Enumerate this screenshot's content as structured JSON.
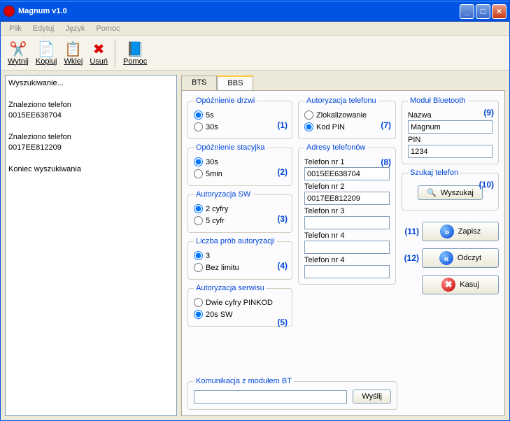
{
  "window": {
    "title": "Magnum v1.0"
  },
  "menu": {
    "file": "Plik",
    "edit": "Edytuj",
    "lang": "Język",
    "help": "Pomoc"
  },
  "toolbar": {
    "cut": "Wytnij",
    "copy": "Kopiuj",
    "paste": "Wklej",
    "delete": "Usuń",
    "help": "Pomoc"
  },
  "log": {
    "searching": "Wyszukiwanie...",
    "found1a": "Znaleziono telefon",
    "found1b": "0015EE638704",
    "found2a": "Znaleziono telefon",
    "found2b": "0017EE812209",
    "end": "Koniec wyszukiwania"
  },
  "tabs": {
    "bts": "BTS",
    "bbs": "BBS"
  },
  "groups": {
    "doorDelay": {
      "title": "Opóźnienie drzwi",
      "opt1": "5s",
      "opt2": "30s",
      "num": "(1)"
    },
    "ignDelay": {
      "title": "Opóźnienie stacyjka",
      "opt1": "30s",
      "opt2": "5min",
      "num": "(2)"
    },
    "authSW": {
      "title": "Autoryzacja SW",
      "opt1": "2 cyfry",
      "opt2": "5 cyfr",
      "num": "(3)"
    },
    "tries": {
      "title": "Liczba prób autoryzacji",
      "opt1": "3",
      "opt2": "Bez limitu",
      "num": "(4)"
    },
    "service": {
      "title": "Autoryzacja serwisu",
      "opt1": "Dwie cyfry PINKOD",
      "opt2": "20s SW",
      "num": "(5)"
    },
    "phoneAuth": {
      "title": "Autoryzacja telefonu",
      "opt1": "Zlokalizowanie",
      "opt2": "Kod PIN",
      "num": "(7)"
    },
    "addresses": {
      "title": "Adresy telefonów",
      "num": "(8)",
      "l1": "Telefon nr 1",
      "v1": "0015EE638704",
      "l2": "Telefon nr 2",
      "v2": "0017EE812209",
      "l3": "Telefon nr 3",
      "v3": "",
      "l4": "Telefon nr 4",
      "v4": "",
      "l5": "Telefon nr 4",
      "v5": ""
    },
    "bt": {
      "title": "Moduł Bluetooth",
      "num": "(9)",
      "nameLbl": "Nazwa",
      "name": "Magnum",
      "pinLbl": "PIN",
      "pin": "1234"
    },
    "search": {
      "title": "Szukaj telefon",
      "num": "(10)",
      "btn": "Wyszukaj"
    },
    "comm": {
      "title": "Komunikacja z modułem BT",
      "btn": "Wyślij"
    }
  },
  "actions": {
    "saveNum": "(11)",
    "save": "Zapisz",
    "readNum": "(12)",
    "read": "Odczyt",
    "delete": "Kasuj"
  }
}
